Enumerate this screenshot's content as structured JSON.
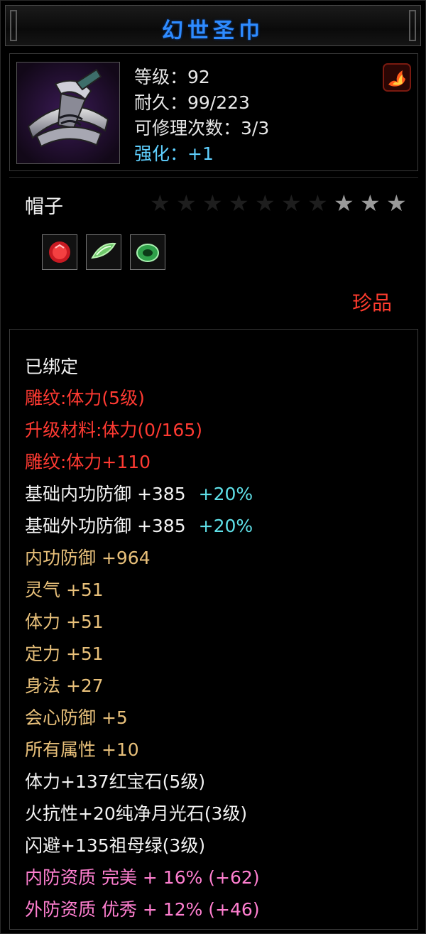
{
  "title": "幻世圣巾",
  "item": {
    "icon": "hat-icon",
    "level_label": "等级：92",
    "durability_label": "耐久：99/223",
    "repair_label": "可修理次数：3/3",
    "enhance_label": "强化：+1",
    "name": "帽子",
    "stars_total": 10,
    "stars_lit": 3,
    "rarity": "珍品"
  },
  "gems": [
    {
      "name": "ruby",
      "color": "#d8202a"
    },
    {
      "name": "moonstone",
      "color": "#6ec86a"
    },
    {
      "name": "emerald",
      "color": "#2fa04a"
    }
  ],
  "attributes": {
    "bound": "已绑定",
    "engrave1": "雕纹:体力(5级)",
    "upgrade_mat": "升级材料:体力(0/165)",
    "engrave2": "雕纹:体力+110",
    "base_inner_def": "基础内功防御  +385",
    "base_inner_pct": "+20%",
    "base_outer_def": "基础外功防御  +385",
    "base_outer_pct": "+20%",
    "inner_def": "内功防御  +964",
    "spirit": "灵气  +51",
    "stamina": "体力  +51",
    "focus": "定力  +51",
    "agility": "身法  +27",
    "crit_def": "会心防御  +5",
    "all_attr": "所有属性  +10",
    "gem1": "体力+137红宝石(5级)",
    "gem2": "火抗性+20纯净月光石(3级)",
    "gem3": "闪避+135祖母绿(3级)",
    "inner_quality": "内防资质  完美  +  16%  (+62)",
    "outer_quality": "外防资质  优秀  +  12%  (+46)"
  },
  "colors": {
    "title": "#2e8bff",
    "red": "#ff3a32",
    "gold": "#e8c07a",
    "pink": "#ff7fd0",
    "cyan": "#5fe0e8",
    "enhance": "#5fd0ff"
  }
}
